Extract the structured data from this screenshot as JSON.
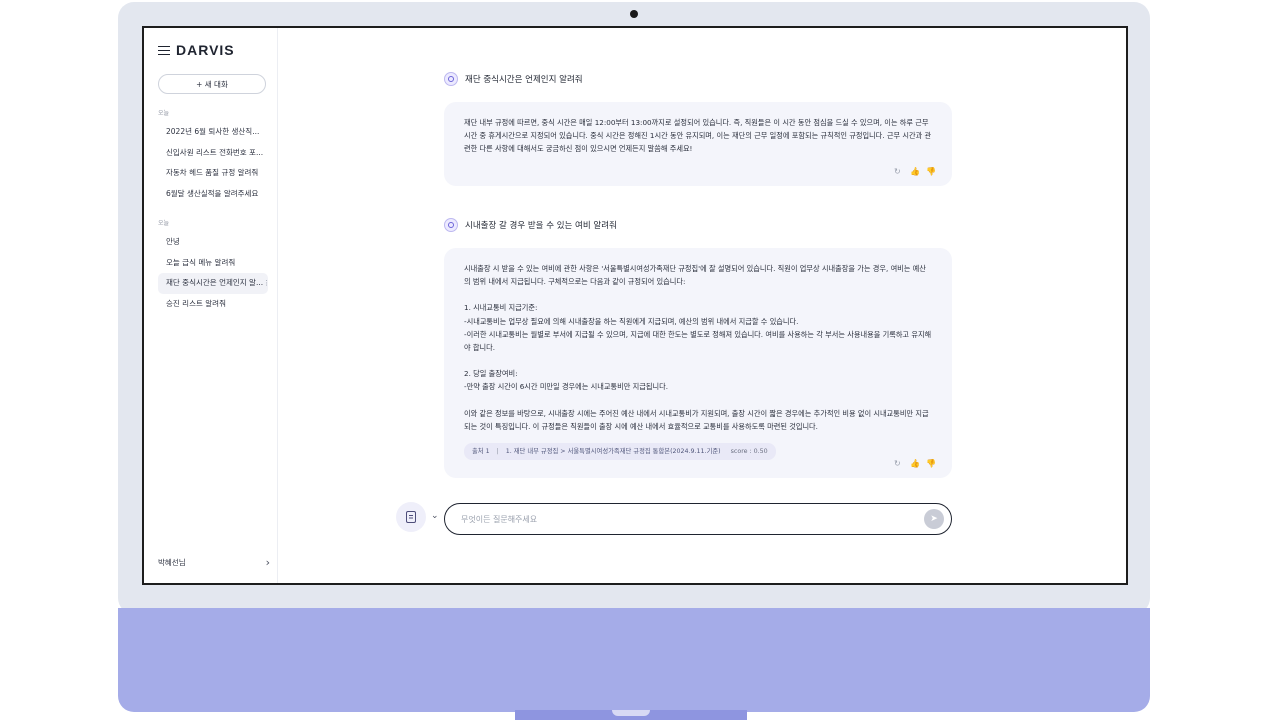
{
  "brand": {
    "logo": "DARVIS"
  },
  "sidebar": {
    "new_chat_label": "+ 새 대화",
    "sections": [
      {
        "label": "오늘",
        "items": [
          "2022년 6월 퇴사한 생산직...",
          "신입사원 리스트 전화번호 포...",
          "자동차 헤드 품질 규정 알려줘",
          "6월달 생산실적을 알려주세요"
        ]
      },
      {
        "label": "오늘",
        "items": [
          "안녕",
          "오늘 급식 메뉴 알려줘",
          "재단 중식시간은 언제인지 알...",
          "승진 리스트 알려줘"
        ]
      }
    ],
    "active_more": "⋮",
    "user_name": "박혜선님",
    "user_chevron": "›"
  },
  "conversation": [
    {
      "question": "재단 중식시간은 언제인지 알려줘",
      "answer": [
        "재단 내부 규정에 따르면, 중식 시간은 매일 12:00부터 13:00까지로 설정되어 있습니다. 즉, 직원들은 이 시간 동안 점심을 드실 수 있으며, 이는 하루 근무시간 중 휴게시간으로 지정되어 있습니다. 중식 시간은 정해진 1시간 동안 유지되며, 이는 재단의 근무 일정에 포함되는 규칙적인 규정입니다. 근무 시간과 관련한 다른 사항에 대해서도 궁금하신 점이 있으시면 언제든지 말씀해 주세요!"
      ]
    },
    {
      "question": "시내출장 갈 경우 받을 수 있는 여비 알려줘",
      "answer": [
        "시내출장 시 받을 수 있는 여비에 관한 사항은 '서울특별시여성가족재단 규정집'에 잘 설명되어 있습니다. 직원이 업무상 시내출장을 가는 경우, 여비는 예산의 범위 내에서 지급됩니다. 구체적으로는 다음과 같이 규정되어 있습니다:",
        "",
        "1. 시내교통비 지급기준:",
        "-시내교통비는 업무상 필요에 의해 시내출장을 하는 직원에게 지급되며, 예산의 범위 내에서 지급할 수 있습니다.",
        "-이러한 시내교통비는 월별로 부서에 지급될 수 있으며, 지급에 대한 한도는 별도로 정해져 있습니다. 여비를 사용하는 각 부서는 사용내용을 기록하고 유지해야 합니다.",
        "",
        "2. 당일 출장여비:",
        "-만약 출장 시간이 6시간 미만일 경우에는 시내교통비만 지급됩니다.",
        "",
        "이와 같은 정보를 바탕으로, 시내출장 시에는 주어진 예산 내에서 시내교통비가 지원되며, 출장 시간이 짧은 경우에는 추가적인 비용 없이 시내교통비만 지급되는 것이 특징입니다. 이 규정들은 직원들이 출장 시에 예산 내에서 효율적으로 교통비를 사용하도록 마련된 것입니다."
      ],
      "source": {
        "label": "출처 1",
        "sep": "|",
        "path": "1. 재단 내부 규정집 > 서울특별시여성가족재단 규정집 통합본(2024.9.11.기준)",
        "score": "score : 0.50"
      }
    }
  ],
  "input": {
    "placeholder": "무엇이든 질문해주세요",
    "chevron": "⌄",
    "send_glyph": "➤"
  },
  "actions": {
    "regenerate": "↻",
    "like": "👍",
    "dislike": "👎"
  },
  "colors": {
    "accent": "#6d64d8",
    "chin": "#a5ace8",
    "bubble": "#f4f5fb"
  }
}
